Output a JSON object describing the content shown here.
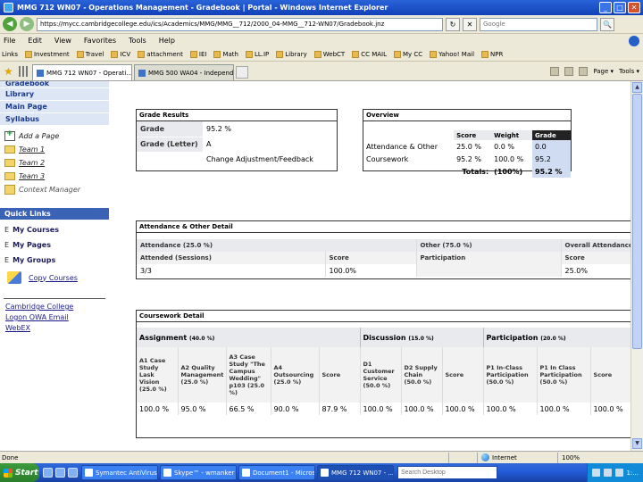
{
  "window": {
    "title": "MMG 712 WN07 - Operations Management - Gradebook | Portal - Windows Internet Explorer",
    "min": "_",
    "max": "□",
    "close": "✕"
  },
  "address": {
    "back": "◀",
    "forward": "▶",
    "url": "https://mycc.cambridgecollege.edu/ics/Academics/MMG/MMG__712/2000_04-MMG__712-WN07/Gradebook.jnz",
    "refresh": "↻",
    "stop": "✕",
    "search_placeholder": "Google",
    "search_go": "🔍"
  },
  "menu": [
    "File",
    "Edit",
    "View",
    "Favorites",
    "Tools",
    "Help"
  ],
  "links": [
    "Links",
    "Investment",
    "Travel",
    "ICV",
    "attachment",
    "IEI",
    "Math",
    "LL.IP",
    "Library",
    "WebCT",
    "CC MAIL",
    "My CC",
    "Yahoo! Mail",
    "NPR"
  ],
  "tabs": [
    {
      "label": "MMG 712 WN07 - Operati...",
      "close": "x"
    },
    {
      "label": "MMG 500 WA04 - Independen...",
      "close": ""
    }
  ],
  "commands": {
    "page": "Page ▾",
    "tools": "Tools ▾"
  },
  "sidebar": {
    "top_items": [
      "Gradebook",
      "Library",
      "Main Page",
      "Syllabus"
    ],
    "add_page": "Add a Page",
    "teams": [
      "Team 1",
      "Team 2",
      "Team 3"
    ],
    "context_manager": "Context Manager",
    "quick_links_title": "Quick Links",
    "quick_links": [
      {
        "prefix": "E",
        "label": "My Courses"
      },
      {
        "prefix": "E",
        "label": "My Pages"
      },
      {
        "prefix": "E",
        "label": "My Groups"
      }
    ],
    "copy_courses": "Copy Courses",
    "external_links": [
      "Cambridge College",
      "Logon OWA Email",
      "WebEX"
    ]
  },
  "grade_results": {
    "title": "Grade Results",
    "grade_label": "Grade",
    "grade_value": "95.2 %",
    "letter_label": "Grade (Letter)",
    "letter_value": "A",
    "adjust_link": "Change Adjustment/Feedback"
  },
  "overview": {
    "title": "Overview",
    "headers": [
      "",
      "Score",
      "Weight",
      "Grade"
    ],
    "rows": [
      {
        "name": "Attendance & Other",
        "score": "25.0 %",
        "weight": "0.0 %",
        "grade": "0.0"
      },
      {
        "name": "Coursework",
        "score": "95.2 %",
        "weight": "100.0 %",
        "grade": "95.2"
      }
    ],
    "totals_label": "Totals:",
    "totals_weight": "(100%)",
    "totals_grade": "95.2 %"
  },
  "attendance": {
    "title": "Attendance & Other Detail",
    "groups": [
      "Attendance (25.0 %)",
      "Other (75.0 %)",
      "Overall Attendance"
    ],
    "cols": [
      "Attended (Sessions)",
      "Score",
      "Participation",
      "Score"
    ],
    "values": [
      "3/3",
      "100.0%",
      "",
      "25.0%"
    ]
  },
  "coursework": {
    "title": "Coursework Detail",
    "groups": [
      {
        "name": "Assignment",
        "pct": "(40.0 %)"
      },
      {
        "name": "Discussion",
        "pct": "(15.0 %)"
      },
      {
        "name": "Participation",
        "pct": "(20.0 %)"
      }
    ],
    "cols": [
      "A1 Case Study Lask Vision (25.0 %)",
      "A2 Quality Management (25.0 %)",
      "A3 Case Study \"The Campus Wedding\" p103 (25.0 %)",
      "A4 Outsourcing (25.0 %)",
      "Score",
      "D1 Customer Service (50.0 %)",
      "D2 Supply Chain (50.0 %)",
      "Score",
      "P1 In-Class Participation (50.0 %)",
      "P1 In Class Participation (50.0 %)",
      "Score"
    ],
    "values": [
      "100.0 %",
      "95.0 %",
      "66.5 %",
      "90.0 %",
      "87.9 %",
      "100.0 %",
      "100.0 %",
      "100.0 %",
      "100.0 %",
      "100.0 %",
      "100.0 %"
    ]
  },
  "status": {
    "left": "Done",
    "zone": "Internet",
    "zoom": "100%"
  },
  "taskbar": {
    "start": "Start",
    "tasks": [
      "Symantec AntiVirus - ...",
      "Skype™ - wmanker",
      "Document1 - Microsof...",
      "MMG 712 WN07 - ..."
    ],
    "search_placeholder": "Search Desktop",
    "clock": "1:..."
  },
  "colors": {
    "accent": "#3a62b5",
    "titlebar": "#1e54d0",
    "highlight": "#cfdcf2"
  }
}
